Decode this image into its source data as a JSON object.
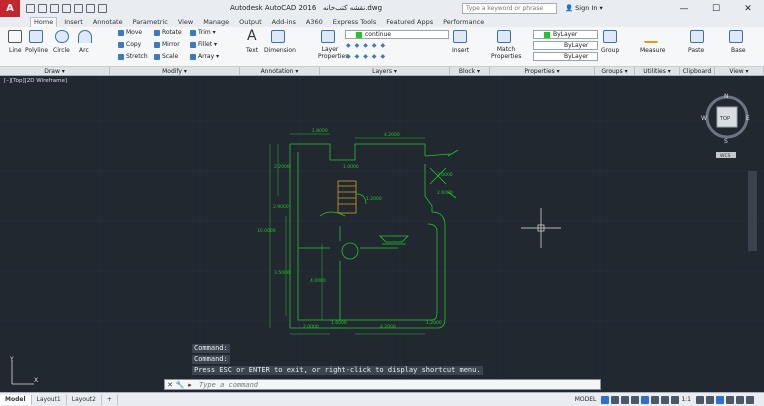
{
  "app": {
    "logo": "A",
    "title": "Autodesk AutoCAD 2016",
    "file": "نقشه کتب‌خانه.dwg",
    "search_placeholder": "Type a keyword or phrase",
    "signin": "Sign In"
  },
  "tabs": [
    "Home",
    "Insert",
    "Annotate",
    "Parametric",
    "View",
    "Manage",
    "Output",
    "Add-ins",
    "A360",
    "Express Tools",
    "Featured Apps",
    "Performance"
  ],
  "active_tab": "Home",
  "ribbon": {
    "draw": {
      "line": "Line",
      "polyline": "Polyline",
      "circle": "Circle",
      "arc": "Arc"
    },
    "modify": {
      "move": "Move",
      "rotate": "Rotate",
      "trim": "Trim",
      "copy": "Copy",
      "mirror": "Mirror",
      "fillet": "Fillet",
      "stretch": "Stretch",
      "scale": "Scale",
      "array": "Array"
    },
    "annotation": {
      "text": "Text",
      "dimension": "Dimension"
    },
    "layers": {
      "layer_properties": "Layer Properties",
      "current_layer": "continue"
    },
    "block": {
      "insert": "Insert"
    },
    "properties": {
      "match": "Match Properties",
      "color": "ByLayer",
      "linetype": "ByLayer",
      "lineweight": "ByLayer"
    },
    "groups": {
      "group": "Group"
    },
    "utilities": {
      "measure": "Measure"
    },
    "clipboard": {
      "paste": "Paste"
    },
    "view": {
      "base": "Base"
    }
  },
  "panels": [
    "Draw ▾",
    "Modify ▾",
    "Annotation ▾",
    "Layers ▾",
    "Block ▾",
    "Properties ▾",
    "Groups ▾",
    "Utilities ▾",
    "Clipboard",
    "View ▾"
  ],
  "viewport": {
    "label": "[–][Top][2D Wireframe]"
  },
  "viewcube": {
    "n": "N",
    "s": "S",
    "e": "E",
    "w": "W",
    "face": "TOP",
    "ucs": "WCS"
  },
  "ucs": {
    "x": "X",
    "y": "Y"
  },
  "drawing": {
    "dims": [
      "1.8000",
      "4.2000",
      "2.2000",
      "1.0000",
      "2.9000",
      "1.2000",
      "3.0000",
      "10.0000",
      "2.6000",
      "3.5000",
      "4.0000",
      "2.0000",
      "1.6000",
      "4.2000",
      "1.2000"
    ]
  },
  "command": {
    "history": [
      "Command:",
      "Command:",
      "Press ESC or ENTER to exit, or right-click to display shortcut menu."
    ],
    "placeholder": "Type a command"
  },
  "layouts": [
    "Model",
    "Layout1",
    "Layout2",
    "+"
  ],
  "status": {
    "model": "MODEL",
    "scale": "1:1"
  },
  "colors": {
    "drawing": "#22c42a",
    "bg": "#212830",
    "brand": "#c4262e"
  }
}
